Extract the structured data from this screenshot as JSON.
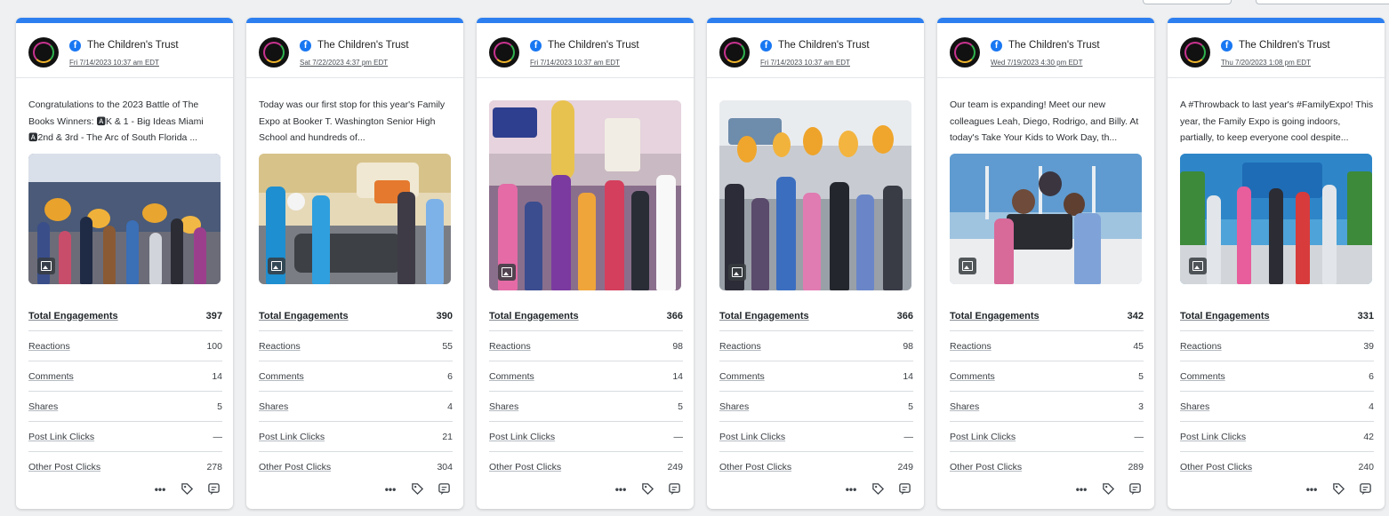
{
  "account_name": "The Children's Trust",
  "posts": [
    {
      "date": "Fri 7/14/2023 10:37 am EDT",
      "text": "Congratulations to the 2023 Battle of The Books Winners: 🅰K & 1 - Big Ideas Miami 🅰2nd & 3rd - The Arc of South Florida ...",
      "metrics": {
        "total": "397",
        "reactions": "100",
        "comments": "14",
        "shares": "5",
        "link_clicks": "—",
        "other_clicks": "278"
      }
    },
    {
      "date": "Sat 7/22/2023 4:37 pm EDT",
      "text": "Today was our first stop for this year's Family Expo at Booker T. Washington Senior High School and hundreds of...",
      "metrics": {
        "total": "390",
        "reactions": "55",
        "comments": "6",
        "shares": "4",
        "link_clicks": "21",
        "other_clicks": "304"
      }
    },
    {
      "date": "Fri 7/14/2023 10:37 am EDT",
      "text": "",
      "metrics": {
        "total": "366",
        "reactions": "98",
        "comments": "14",
        "shares": "5",
        "link_clicks": "—",
        "other_clicks": "249"
      }
    },
    {
      "date": "Fri 7/14/2023 10:37 am EDT",
      "text": "",
      "metrics": {
        "total": "366",
        "reactions": "98",
        "comments": "14",
        "shares": "5",
        "link_clicks": "—",
        "other_clicks": "249"
      }
    },
    {
      "date": "Wed 7/19/2023 4:30 pm EDT",
      "text": "Our team is expanding! Meet our new colleagues Leah, Diego, Rodrigo, and Billy. At today's Take Your Kids to Work Day, th...",
      "metrics": {
        "total": "342",
        "reactions": "45",
        "comments": "5",
        "shares": "3",
        "link_clicks": "—",
        "other_clicks": "289"
      }
    },
    {
      "date": "Thu 7/20/2023 1:08 pm EDT",
      "text": "A #Throwback to last year's #FamilyExpo! This year, the Family Expo is going indoors, partially, to keep everyone cool despite...",
      "metrics": {
        "total": "331",
        "reactions": "39",
        "comments": "6",
        "shares": "4",
        "link_clicks": "42",
        "other_clicks": "240"
      }
    }
  ],
  "labels": {
    "total": "Total Engagements",
    "reactions": "Reactions",
    "comments": "Comments",
    "shares": "Shares",
    "link_clicks": "Post Link Clicks",
    "other_clicks": "Other Post Clicks"
  },
  "icons": {
    "network": "facebook-icon",
    "media_type": "image-icon",
    "more": "more-dots-icon",
    "tag": "tag-icon",
    "notes": "notes-icon"
  },
  "colors": {
    "accent": "#2d7ff0",
    "facebook": "#1877f2"
  }
}
